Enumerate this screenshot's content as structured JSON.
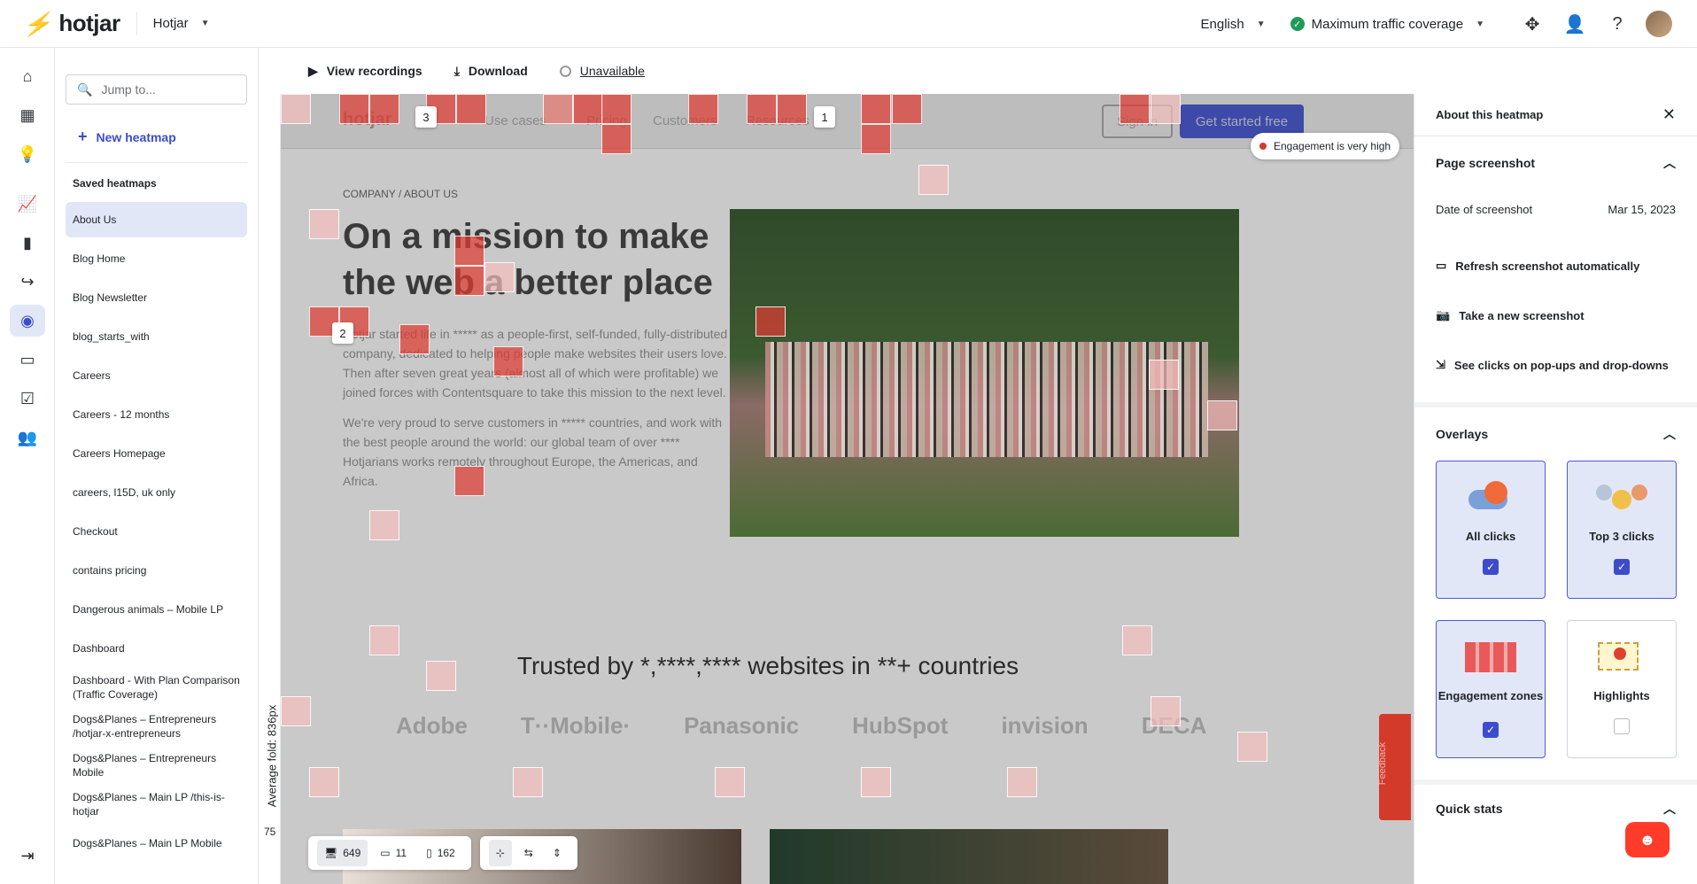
{
  "topbar": {
    "logo": "hotjar",
    "org": "Hotjar",
    "language": "English",
    "traffic": "Maximum traffic coverage"
  },
  "sidebar": {
    "jump_placeholder": "Jump to...",
    "new_heatmap": "New heatmap",
    "saved_title": "Saved heatmaps",
    "items": [
      "About Us",
      "Blog Home",
      "Blog Newsletter",
      "blog_starts_with",
      "Careers",
      "Careers - 12 months",
      "Careers Homepage",
      "careers, l15D, uk only",
      "Checkout",
      "contains pricing",
      "Dangerous animals – Mobile LP",
      "Dashboard",
      "Dashboard - With Plan Comparison (Traffic Coverage)",
      "Dogs&Planes – Entrepreneurs /hotjar-x-entrepreneurs",
      "Dogs&Planes – Entrepreneurs Mobile",
      "Dogs&Planes – Main LP /this-is-hotjar",
      "Dogs&Planes – Main LP Mobile"
    ]
  },
  "toolbar": {
    "view_recordings": "View recordings",
    "download": "Download",
    "unavailable": "Unavailable"
  },
  "canvas": {
    "fold_label": "Average fold: 836px",
    "fold_value": "75",
    "nav_logo": "hotjar",
    "nav_links": [
      "Use cases",
      "Pricing",
      "Customers",
      "Resources"
    ],
    "sign_in": "Sign in",
    "get_started": "Get started free",
    "engagement_tip": "Engagement is very high",
    "breadcrumb": "COMPANY / ABOUT US",
    "hero_title": "On a mission to make the web a better place",
    "hero_body_1": "Hotjar started life in ***** as a people-first, self-funded, fully-distributed company, dedicated to helping people make websites their users love. Then after seven great years (almost all of which were profitable) we joined forces with Contentsquare to take this mission to the next level.",
    "hero_body_2": "We're very proud to serve customers in ***** countries, and work with the best people around the world: our global team of over **** Hotjarians works remotely throughout Europe, the Americas, and Africa.",
    "trusted": "Trusted by *,****,**** websites in **+ countries",
    "logos": [
      "Adobe",
      "T··Mobile·",
      "Panasonic",
      "HubSpot",
      "invision",
      "DECA"
    ],
    "markers": [
      "3",
      "1",
      "2"
    ],
    "feedback": "Feedback"
  },
  "bottom_tools": {
    "desktop_count": "649",
    "tablet_count": "11",
    "mobile_count": "162"
  },
  "panel": {
    "title": "About this heatmap",
    "page_screenshot": "Page screenshot",
    "date_label": "Date of screenshot",
    "date_value": "Mar 15, 2023",
    "refresh": "Refresh screenshot automatically",
    "take_new": "Take a new screenshot",
    "see_clicks": "See clicks on pop-ups and drop-downs",
    "overlays": "Overlays",
    "overlay_cards": [
      {
        "label": "All clicks",
        "checked": true
      },
      {
        "label": "Top 3 clicks",
        "checked": true
      },
      {
        "label": "Engagement zones",
        "checked": true
      },
      {
        "label": "Highlights",
        "checked": false
      }
    ],
    "quick_stats": "Quick stats"
  }
}
